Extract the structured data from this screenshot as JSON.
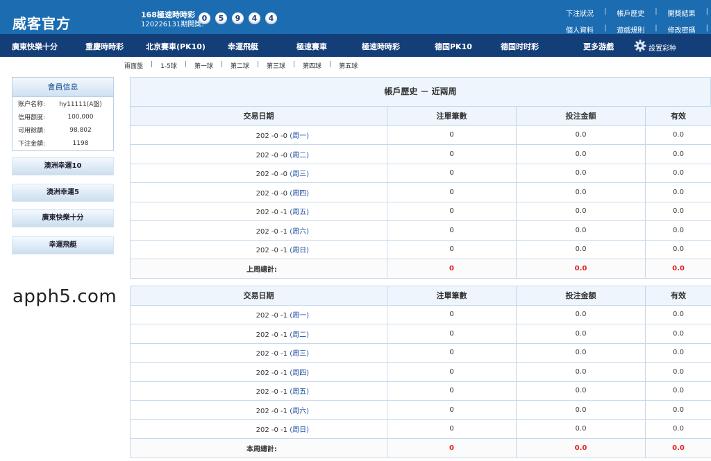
{
  "header": {
    "logo": "威客官方",
    "lottery_title": "168極速時時彩",
    "draw_number": "120226131期開獎:",
    "balls": [
      "0",
      "5",
      "9",
      "4",
      "4"
    ],
    "links_row1": [
      "下注狀況",
      "帳戶歷史",
      "開獎結果"
    ],
    "links_row2": [
      "個人資料",
      "遊戲規則",
      "修改密碼"
    ]
  },
  "nav": {
    "items": [
      "廣東快樂十分",
      "重慶時時彩",
      "北京賽車(PK10)",
      "幸運飛艇",
      "極速賽車",
      "極速時時彩",
      "德国PK10",
      "德国时时彩",
      "更多游戲"
    ],
    "settings_label": "設置彩种"
  },
  "subnav": [
    "兩面盤",
    "1-5球",
    "第一球",
    "第二球",
    "第三球",
    "第四球",
    "第五球"
  ],
  "member": {
    "title": "會員信息",
    "rows": [
      {
        "label": "账户名称:",
        "value": "hy11111(A盤)"
      },
      {
        "label": "信用额度:",
        "value": "100,000"
      },
      {
        "label": "可用餘額:",
        "value": "98,802"
      },
      {
        "label": "下注金額:",
        "value": "1198"
      }
    ]
  },
  "side_buttons": [
    "澳洲幸運10",
    "澳洲幸運5",
    "廣東快樂十分",
    "幸運飛艇"
  ],
  "watermark": "apph5.com",
  "history": {
    "title": "帳戶歷史 － 近兩周",
    "columns": [
      "交易日期",
      "注單筆數",
      "投注金额",
      "有效"
    ],
    "last_week": {
      "rows": [
        {
          "date": "202 -0 -0",
          "weekday": "(周一)",
          "count": "0",
          "amount": "0.0",
          "valid": "0.0"
        },
        {
          "date": "202 -0 -0",
          "weekday": "(周二)",
          "count": "0",
          "amount": "0.0",
          "valid": "0.0"
        },
        {
          "date": "202 -0 -0",
          "weekday": "(周三)",
          "count": "0",
          "amount": "0.0",
          "valid": "0.0"
        },
        {
          "date": "202 -0 -0",
          "weekday": "(周四)",
          "count": "0",
          "amount": "0.0",
          "valid": "0.0"
        },
        {
          "date": "202 -0 -1",
          "weekday": "(周五)",
          "count": "0",
          "amount": "0.0",
          "valid": "0.0"
        },
        {
          "date": "202 -0 -1",
          "weekday": "(周六)",
          "count": "0",
          "amount": "0.0",
          "valid": "0.0"
        },
        {
          "date": "202 -0 -1",
          "weekday": "(周日)",
          "count": "0",
          "amount": "0.0",
          "valid": "0.0"
        }
      ],
      "total_label": "上周總計:",
      "total_count": "0",
      "total_amount": "0.0",
      "total_valid": "0.0"
    },
    "this_week": {
      "rows": [
        {
          "date": "202 -0 -1",
          "weekday": "(周一)",
          "count": "0",
          "amount": "0.0",
          "valid": "0.0"
        },
        {
          "date": "202 -0 -1",
          "weekday": "(周二)",
          "count": "0",
          "amount": "0.0",
          "valid": "0.0"
        },
        {
          "date": "202 -0 -1",
          "weekday": "(周三)",
          "count": "0",
          "amount": "0.0",
          "valid": "0.0"
        },
        {
          "date": "202 -0 -1",
          "weekday": "(周四)",
          "count": "0",
          "amount": "0.0",
          "valid": "0.0"
        },
        {
          "date": "202 -0 -1",
          "weekday": "(周五)",
          "count": "0",
          "amount": "0.0",
          "valid": "0.0"
        },
        {
          "date": "202 -0 -1",
          "weekday": "(周六)",
          "count": "0",
          "amount": "0.0",
          "valid": "0.0"
        },
        {
          "date": "202 -0 -1",
          "weekday": "(周日)",
          "count": "0",
          "amount": "0.0",
          "valid": "0.0"
        }
      ],
      "total_label": "本周總計:",
      "total_count": "0",
      "total_amount": "0.0",
      "total_valid": "0.0"
    }
  },
  "colors": {
    "header_blue": "#1c6cb2",
    "nav_navy": "#143e78",
    "total_red": "#e02020",
    "weekday_blue": "#1d4fa0"
  }
}
